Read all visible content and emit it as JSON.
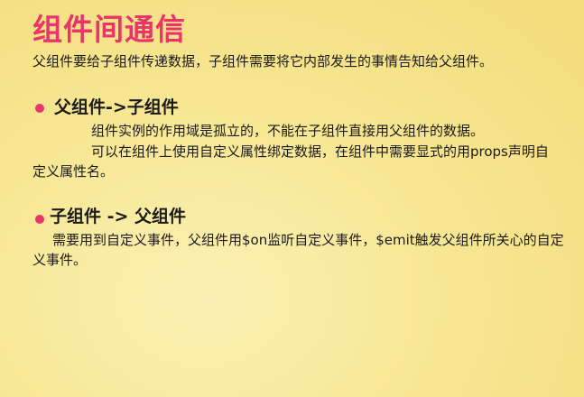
{
  "slide": {
    "title": "组件间通信",
    "subtitle": "父组件要给子组件传递数据，子组件需要将它内部发生的事情告知给父组件。",
    "sections": [
      {
        "heading": "父组件->子组件",
        "paragraphs": [
          "组件实例的作用域是孤立的，不能在子组件直接用父组件的数据。",
          "可以在组件上使用自定义属性绑定数据，在组件中需要显式的用props声明自定义属性名。"
        ]
      },
      {
        "heading": "子组件 -> 父组件",
        "paragraphs": [
          "需要用到自定义事件，父组件用$on监听自定义事件，$emit触发父组件所关心的自定义事件。"
        ]
      }
    ]
  },
  "colors": {
    "accent": "#e8356a",
    "background": "#f7e793",
    "text": "#1a1a1a"
  }
}
